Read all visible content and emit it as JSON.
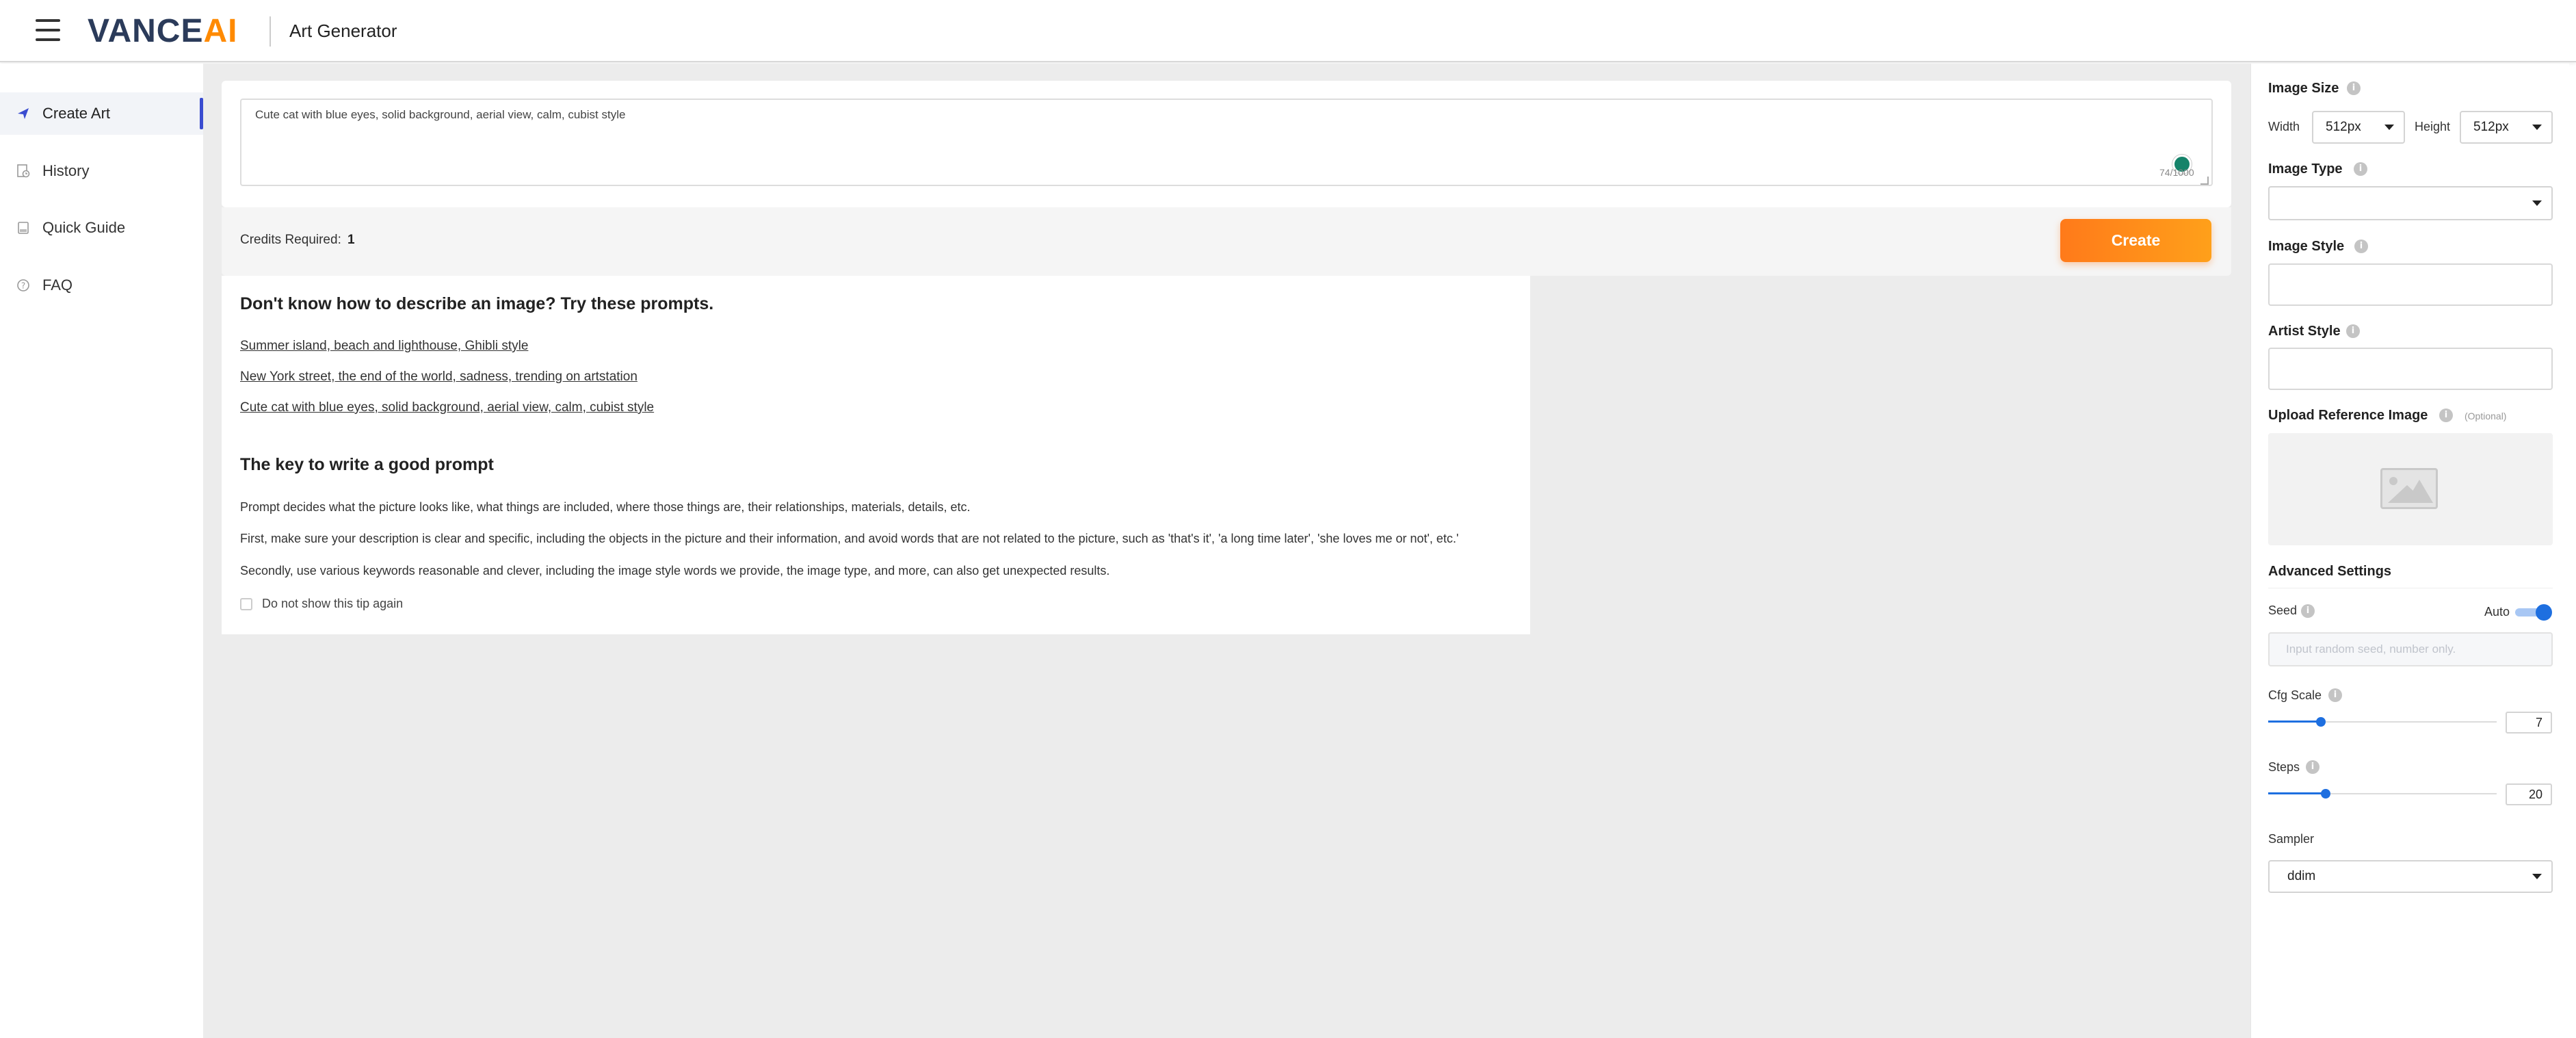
{
  "header": {
    "logo_main": "VANCE",
    "logo_accent": "AI",
    "title": "Art Generator"
  },
  "sidebar": {
    "items": [
      {
        "label": "Create Art",
        "icon": "paper-plane-icon",
        "active": true
      },
      {
        "label": "History",
        "icon": "history-icon"
      },
      {
        "label": "Quick Guide",
        "icon": "book-icon"
      },
      {
        "label": "FAQ",
        "icon": "question-icon"
      }
    ]
  },
  "prompt": {
    "value": "Cute cat with blue eyes, solid background, aerial view, calm, cubist style",
    "char_count": "74/1000"
  },
  "credits": {
    "label": "Credits Required:",
    "value": "1",
    "create_label": "Create"
  },
  "tips": {
    "heading1": "Don't know how to describe an image? Try these prompts.",
    "examples": [
      "Summer island, beach and lighthouse, Ghibli style",
      "New York street, the end of the world, sadness, trending on artstation",
      "Cute cat with blue eyes, solid background, aerial view, calm, cubist style"
    ],
    "heading2": "The key to write a good prompt",
    "paragraphs": [
      "Prompt decides what the picture looks like, what things are included, where those things are, their relationships, materials, details, etc.",
      "First, make sure your description is clear and specific, including the objects in the picture and their information, and avoid words that are not related to the picture, such as 'that's it', 'a long time later', 'she loves me or not', etc.'",
      "Secondly, use various keywords reasonable and clever, including the image style words we provide, the image type, and more, can also get unexpected results."
    ],
    "checkbox_label": "Do not show this tip again"
  },
  "settings": {
    "image_size": {
      "label": "Image Size",
      "width_label": "Width",
      "width_value": "512px",
      "height_label": "Height",
      "height_value": "512px"
    },
    "image_type": {
      "label": "Image Type",
      "value": ""
    },
    "image_style": {
      "label": "Image Style"
    },
    "artist_style": {
      "label": "Artist Style"
    },
    "upload": {
      "label": "Upload Reference Image",
      "optional": "(Optional)"
    },
    "advanced": {
      "label": "Advanced Settings"
    },
    "seed": {
      "label": "Seed",
      "auto_label": "Auto",
      "auto_on": true,
      "placeholder": "Input random seed, number only."
    },
    "cfg_scale": {
      "label": "Cfg Scale",
      "value": "7",
      "fraction": 0.23
    },
    "steps": {
      "label": "Steps",
      "value": "20",
      "fraction": 0.25
    },
    "sampler": {
      "label": "Sampler",
      "value": "ddim"
    }
  },
  "colors": {
    "accent_orange": "#ff8a00",
    "accent_blue": "#1e6fe0",
    "active_nav_bar": "#3a4cd0"
  }
}
